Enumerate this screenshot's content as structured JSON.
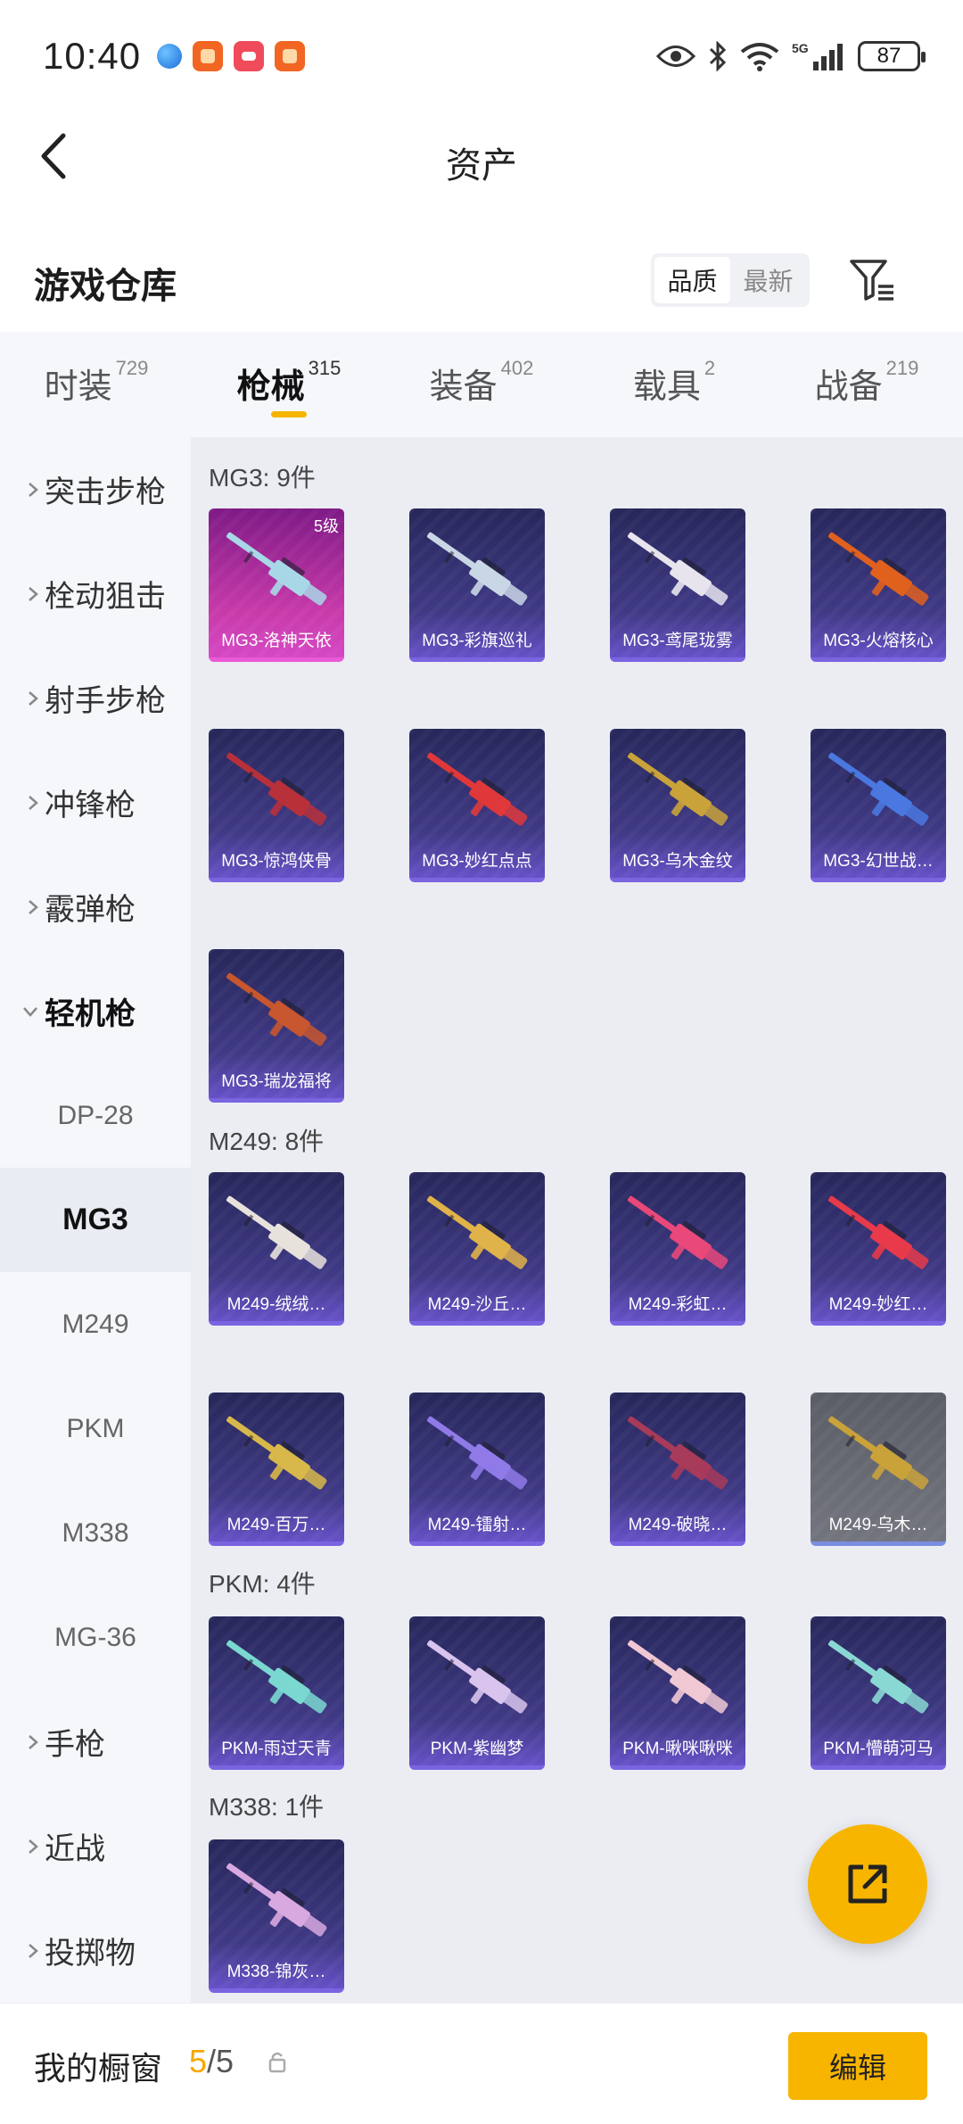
{
  "status_bar": {
    "time": "10:40",
    "battery": "87",
    "notification_icons": [
      "browser-icon",
      "app-icon",
      "mail-icon",
      "app-icon"
    ],
    "system_icons": [
      "eye-icon",
      "bluetooth-icon",
      "wifi-icon",
      "5g-signal-icon"
    ]
  },
  "header": {
    "title": "资产"
  },
  "warehouse": {
    "title": "游戏仓库",
    "sort_options": [
      "品质",
      "最新"
    ],
    "sort_selected": "品质"
  },
  "tabs": [
    {
      "label": "时装",
      "count": "729",
      "active": false
    },
    {
      "label": "枪械",
      "count": "315",
      "active": true
    },
    {
      "label": "装备",
      "count": "402",
      "active": false
    },
    {
      "label": "载具",
      "count": "2",
      "active": false
    },
    {
      "label": "战备",
      "count": "219",
      "active": false
    }
  ],
  "sidebar": {
    "categories": [
      {
        "label": "突击步枪",
        "expanded": false
      },
      {
        "label": "栓动狙击",
        "expanded": false
      },
      {
        "label": "射手步枪",
        "expanded": false
      },
      {
        "label": "冲锋枪",
        "expanded": false
      },
      {
        "label": "霰弹枪",
        "expanded": false
      },
      {
        "label": "轻机枪",
        "expanded": true
      },
      {
        "label": "手枪",
        "expanded": false
      },
      {
        "label": "近战",
        "expanded": false
      },
      {
        "label": "投掷物",
        "expanded": false
      }
    ],
    "subitems": [
      {
        "label": "DP-28",
        "active": false
      },
      {
        "label": "MG3",
        "active": true
      },
      {
        "label": "M249",
        "active": false
      },
      {
        "label": "PKM",
        "active": false
      },
      {
        "label": "M338",
        "active": false
      },
      {
        "label": "MG-36",
        "active": false
      }
    ]
  },
  "sections": [
    {
      "title": "MG3: 9件",
      "items": [
        {
          "name": "MG3-洛神天依",
          "badge": "5级",
          "style": "pink",
          "accent": "#a8d8e8"
        },
        {
          "name": "MG3-彩旗巡礼",
          "style": "purple",
          "accent": "#c9d6e6"
        },
        {
          "name": "MG3-鸢尾珑雾",
          "style": "purple",
          "accent": "#e8e4ee"
        },
        {
          "name": "MG3-火熔核心",
          "style": "purple",
          "accent": "#e0601e"
        },
        {
          "name": "MG3-惊鸿侠骨",
          "style": "purple",
          "accent": "#b8303a"
        },
        {
          "name": "MG3-妙红点点",
          "style": "purple",
          "accent": "#e0383a"
        },
        {
          "name": "MG3-乌木金纹",
          "style": "purple",
          "accent": "#c9a23a"
        },
        {
          "name": "MG3-幻世战…",
          "style": "purple",
          "accent": "#4a78e0"
        },
        {
          "name": "MG3-瑞龙福将",
          "style": "purple",
          "accent": "#c8562e"
        }
      ]
    },
    {
      "title": "M249: 8件",
      "items": [
        {
          "name": "M249-绒绒…",
          "style": "purple",
          "accent": "#e8e2dc"
        },
        {
          "name": "M249-沙丘…",
          "style": "purple",
          "accent": "#e0b24a"
        },
        {
          "name": "M249-彩虹…",
          "style": "purple",
          "accent": "#e8487a"
        },
        {
          "name": "M249-妙红…",
          "style": "purple",
          "accent": "#e83a4a"
        },
        {
          "name": "M249-百万…",
          "style": "purple",
          "accent": "#d8b84a"
        },
        {
          "name": "M249-镭射…",
          "style": "purple",
          "accent": "#8f7ae8"
        },
        {
          "name": "M249-破晓…",
          "style": "purple",
          "accent": "#a83a5a"
        },
        {
          "name": "M249-乌木…",
          "style": "gray",
          "accent": "#c9a23a"
        }
      ]
    },
    {
      "title": "PKM: 4件",
      "items": [
        {
          "name": "PKM-雨过天青",
          "style": "purple",
          "accent": "#7ad8d0"
        },
        {
          "name": "PKM-紫幽梦",
          "style": "purple",
          "accent": "#d8c4ec"
        },
        {
          "name": "PKM-啾咪啾咪",
          "style": "purple",
          "accent": "#f0c8d4"
        },
        {
          "name": "PKM-懵萌河马",
          "style": "purple",
          "accent": "#8ad8d4"
        }
      ]
    },
    {
      "title": "M338: 1件",
      "items": [
        {
          "name": "M338-锦灰…",
          "style": "purple",
          "accent": "#d8a8e0"
        }
      ]
    }
  ],
  "bottom_bar": {
    "label": "我的橱窗",
    "count_current": "5",
    "count_total": "/5",
    "edit_label": "编辑"
  }
}
